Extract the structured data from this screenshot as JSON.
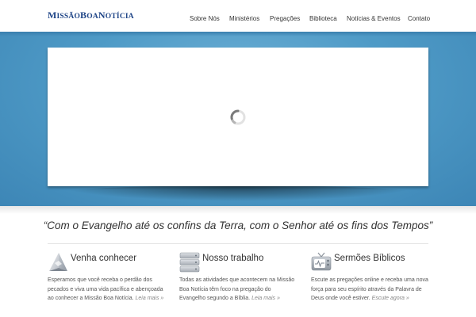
{
  "header": {
    "logo_parts": {
      "a": "M",
      "b": "ISSÃO",
      "c": "B",
      "d": "OA",
      "e": "N",
      "f": "OTÍCIA"
    },
    "nav": [
      "Sobre Nós",
      "Ministérios",
      "Pregações",
      "Biblioteca",
      "Notícias & Eventos",
      "Contato"
    ]
  },
  "hero": {
    "state": "loading"
  },
  "tagline": "“Com o Evangelho até os confins da Terra, com o Senhor até os fins dos Tempos”",
  "columns": [
    {
      "icon": "pyramid-icon",
      "title": "Venha conhecer",
      "text": "Esperamos que você receba o perdão dos pecados e viva uma vida pacífica e abençoada ao conhecer a Missão Boa Notícia.",
      "more": "Leia mais »"
    },
    {
      "icon": "server-stack-icon",
      "title": "Nosso trabalho",
      "text": "Todas as atividades que acontecem na Missão Boa Notícia têm foco na pregação do Evangelho segundo a Bíblia.",
      "more": "Leia mais »"
    },
    {
      "icon": "tv-icon",
      "title": "Sermões Bíblicos",
      "text": "Escute as pregações online e receba uma nova força para seu espírito através da Palavra de Deus onde você estiver.",
      "more": "Escute agora »"
    }
  ],
  "colors": {
    "brand": "#1f4587",
    "hero_blue": "#4f9bc7"
  }
}
